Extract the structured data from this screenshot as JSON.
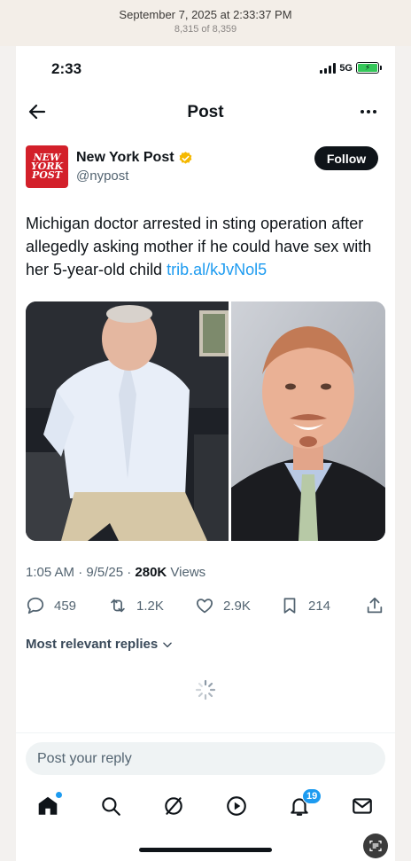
{
  "photo_viewer": {
    "date": "September 7, 2025 at 2:33:37 PM",
    "count": "8,315 of 8,359"
  },
  "status_bar": {
    "time": "2:33",
    "network": "5G",
    "battery_icon": "battery-charging-icon"
  },
  "nav": {
    "title": "Post",
    "back_icon": "back-arrow-icon",
    "more_icon": "more-icon"
  },
  "author": {
    "name": "New York Post",
    "handle": "@nypost",
    "avatar_text": [
      "NEW",
      "YORK",
      "POST"
    ],
    "follow_label": "Follow",
    "verified_color": "#f5b800"
  },
  "post": {
    "text": "Michigan doctor arrested in sting operation after allegedly asking mother if he could have sex with her 5-year-old child ",
    "link": "trib.al/kJvNol5",
    "images": [
      "photo-arrest",
      "photo-portrait"
    ]
  },
  "meta": {
    "time_date": "1:05 AM · 9/5/25 · ",
    "views_count": "280K",
    "views_label": " Views"
  },
  "actions": {
    "replies": "459",
    "reposts": "1.2K",
    "likes": "2.9K",
    "bookmarks": "214"
  },
  "replies_sort": {
    "label": "Most relevant replies"
  },
  "reply_input": {
    "placeholder": "Post your reply"
  },
  "tabbar": {
    "notifications_badge": "19",
    "icons": [
      "home-icon",
      "search-icon",
      "grok-icon",
      "video-icon",
      "bell-icon",
      "mail-icon"
    ]
  },
  "colors": {
    "accent": "#1d9bf0",
    "brand_red": "#d3202a",
    "text_primary": "#0f1419",
    "text_secondary": "#536471"
  }
}
